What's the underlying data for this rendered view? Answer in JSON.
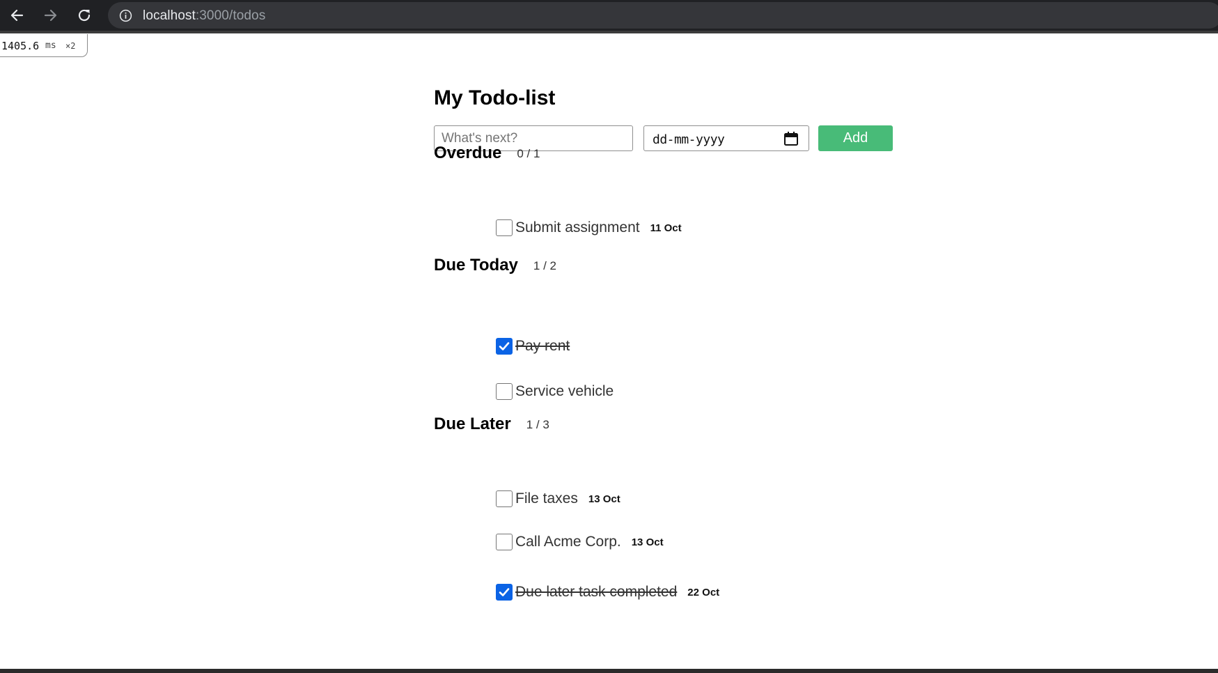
{
  "browser": {
    "url_host": "localhost",
    "url_rest": ":3000/todos"
  },
  "perf_badge": {
    "ms_value": "1405.6",
    "ms_unit": "ms",
    "multiplier": "×2"
  },
  "app": {
    "title": "My Todo-list",
    "input_placeholder": "What's next?",
    "date_placeholder": "dd-mm-yyyy",
    "add_label": "Add",
    "add_color": "#48bb78"
  },
  "sections": [
    {
      "title": "Overdue",
      "count": "0 / 1",
      "items": [
        {
          "label": "Submit assignment",
          "date": "11 Oct",
          "done": false
        }
      ]
    },
    {
      "title": "Due Today",
      "count": "1 / 2",
      "items": [
        {
          "label": "Pay rent",
          "date": "",
          "done": true
        },
        {
          "label": "Service vehicle",
          "date": "",
          "done": false
        }
      ]
    },
    {
      "title": "Due Later",
      "count": "1 / 3",
      "items": [
        {
          "label": "File taxes",
          "date": "13 Oct",
          "done": false
        },
        {
          "label": "Call Acme Corp.",
          "date": "13 Oct",
          "done": false
        },
        {
          "label": "Due later task completed",
          "date": "22 Oct",
          "done": true
        }
      ]
    }
  ],
  "colors": {
    "checkbox_checked": "#0b63e5",
    "chrome_bg": "#202124"
  }
}
